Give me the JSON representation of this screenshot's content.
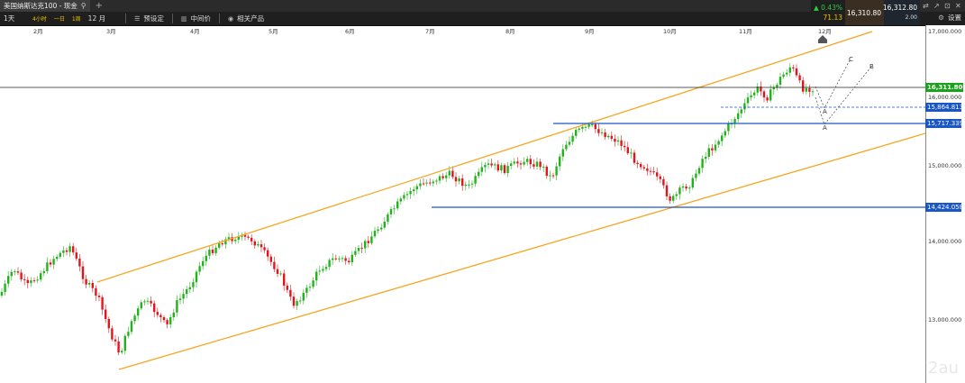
{
  "window": {
    "tab_title": "美国纳斯达克100 - 现金",
    "plus": "+",
    "controls": [
      "⇄",
      "↗",
      "⊡",
      "✕"
    ]
  },
  "toolbar": {
    "timeframe": "1天",
    "intervals": [
      "4小时",
      "一日",
      "1周"
    ],
    "month": "12 月",
    "buttons": [
      "预设定",
      "中间价",
      "相关产品"
    ],
    "settings": "设置"
  },
  "quote": {
    "change_pct": "▲ 0.43%",
    "change_pts": "71.13",
    "bid": "16,310.80",
    "ask": "16,312.80",
    "spread": "2.00"
  },
  "x_axis": [
    "2月",
    "3月",
    "4月",
    "5月",
    "6月",
    "7月",
    "8月",
    "9月",
    "10月",
    "11月",
    "12月"
  ],
  "y_axis": [
    "17,000.000",
    "16,000.000",
    "15,000.000",
    "14,000.000",
    "13,000.000"
  ],
  "price_tags": {
    "last": "16,311.800",
    "dashed": "15,864.813",
    "resistance": "15,717.339",
    "support": "14,424.058"
  },
  "annotations": [
    "A",
    "A",
    "C",
    "B"
  ],
  "watermark": "2au",
  "colors": {
    "channel": "#f5a623",
    "level": "#1a56c4",
    "up": "#22b31c",
    "down": "#e5141b",
    "last_tag": "#1aa31a"
  }
}
